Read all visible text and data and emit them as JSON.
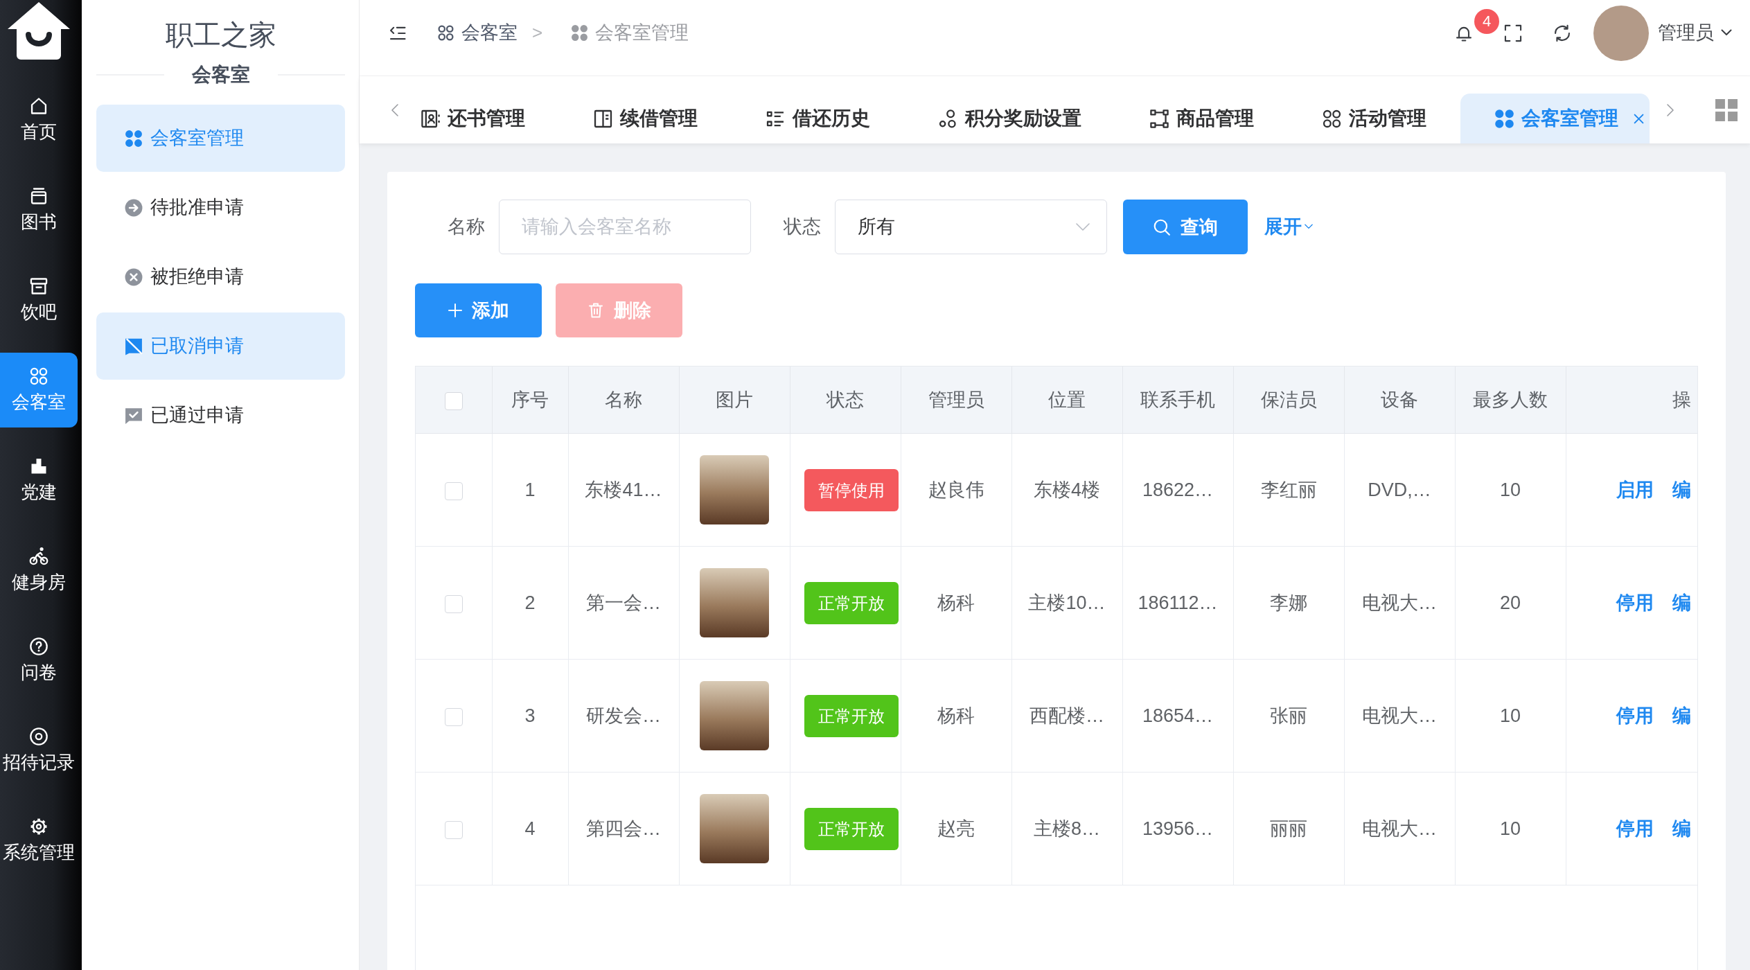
{
  "rail": {
    "items": [
      {
        "label": "首页",
        "selected": false
      },
      {
        "label": "图书",
        "selected": false
      },
      {
        "label": "饮吧",
        "selected": false
      },
      {
        "label": "会客室",
        "selected": true
      },
      {
        "label": "党建",
        "selected": false
      },
      {
        "label": "健身房",
        "selected": false
      },
      {
        "label": "问卷",
        "selected": false
      },
      {
        "label": "招待记录",
        "selected": false
      },
      {
        "label": "系统管理",
        "selected": false
      }
    ]
  },
  "submenu": {
    "title": "职工之家",
    "subtitle": "会客室",
    "items": [
      {
        "label": "会客室管理",
        "selected": true
      },
      {
        "label": "待批准申请",
        "selected": false
      },
      {
        "label": "被拒绝申请",
        "selected": false
      },
      {
        "label": "已取消申请",
        "selected": true
      },
      {
        "label": "已通过申请",
        "selected": false
      }
    ]
  },
  "header": {
    "breadcrumb": [
      {
        "label": "会客室",
        "current": false
      },
      {
        "label": "会客室管理",
        "current": true
      }
    ],
    "breadcrumb_separator": ">",
    "notification_count": "4",
    "user": "管理员"
  },
  "tabs": [
    {
      "label": "还书管理",
      "selected": false
    },
    {
      "label": "续借管理",
      "selected": false
    },
    {
      "label": "借还历史",
      "selected": false
    },
    {
      "label": "积分奖励设置",
      "selected": false
    },
    {
      "label": "商品管理",
      "selected": false
    },
    {
      "label": "活动管理",
      "selected": false
    },
    {
      "label": "会客室管理",
      "selected": true
    }
  ],
  "filters": {
    "name": {
      "label": "名称",
      "placeholder": "请输入会客室名称"
    },
    "status": {
      "label": "状态",
      "value": "所有"
    },
    "search_button": "查询",
    "expand_link": "展开"
  },
  "toolbar": {
    "add_button": "添加",
    "delete_button": {
      "label": "删除",
      "disabled": true
    }
  },
  "table": {
    "all_checked": false,
    "columns": [
      "序号",
      "名称",
      "图片",
      "状态",
      "管理员",
      "位置",
      "联系手机",
      "保洁员",
      "设备",
      "最多人数",
      "操"
    ],
    "rows": [
      {
        "checked": false,
        "index": "1",
        "name": "东楼41…",
        "status": {
          "text": "暂停使用",
          "color": "#f4595d"
        },
        "manager": "赵良伟",
        "location": "东楼4楼",
        "phone": "18622…",
        "cleaner": "李红丽",
        "equipment": "DVD,…",
        "capacity": "10",
        "actions": [
          "启用",
          "编"
        ]
      },
      {
        "checked": false,
        "index": "2",
        "name": "第一会…",
        "status": {
          "text": "正常开放",
          "color": "#52c41a"
        },
        "manager": "杨科",
        "location": "主楼10…",
        "phone": "186112…",
        "cleaner": "李娜",
        "equipment": "电视大…",
        "capacity": "20",
        "actions": [
          "停用",
          "编"
        ]
      },
      {
        "checked": false,
        "index": "3",
        "name": "研发会…",
        "status": {
          "text": "正常开放",
          "color": "#52c41a"
        },
        "manager": "杨科",
        "location": "西配楼…",
        "phone": "18654…",
        "cleaner": "张丽",
        "equipment": "电视大…",
        "capacity": "10",
        "actions": [
          "停用",
          "编"
        ]
      },
      {
        "checked": false,
        "index": "4",
        "name": "第四会…",
        "status": {
          "text": "正常开放",
          "color": "#52c41a"
        },
        "manager": "赵亮",
        "location": "主楼8…",
        "phone": "13956…",
        "cleaner": "丽丽",
        "equipment": "电视大…",
        "capacity": "10",
        "actions": [
          "停用",
          "编"
        ]
      }
    ]
  }
}
